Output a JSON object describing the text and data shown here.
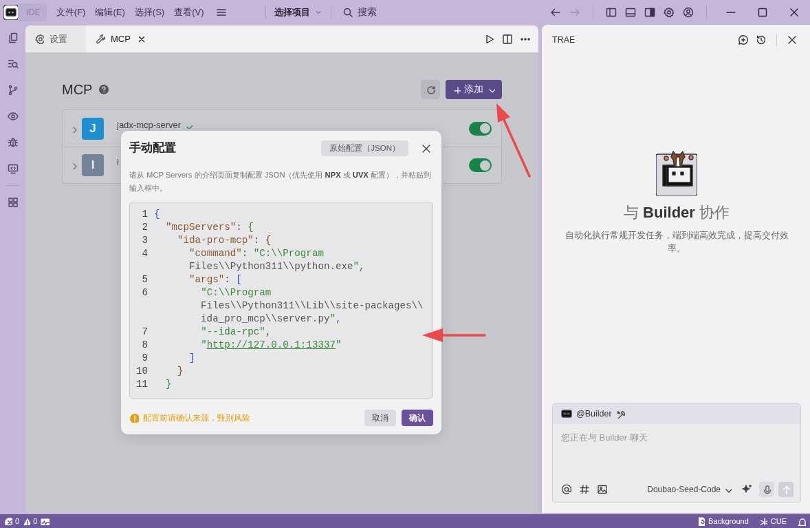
{
  "titlebar": {
    "mode_label": "IDE",
    "menus": [
      "文件(F)",
      "编辑(E)",
      "选择(S)",
      "查看(V)"
    ],
    "project": "选择项目",
    "search": "搜索"
  },
  "editor": {
    "tabs": [
      {
        "label": "设置",
        "kind": "settings",
        "selected": false
      },
      {
        "label": "MCP",
        "kind": "tool",
        "selected": true
      }
    ]
  },
  "page": {
    "title": "MCP",
    "add_button": "添加",
    "servers": [
      {
        "initial": "J",
        "name": "jadx-mcp-server",
        "color": "#1f8fd2",
        "verified": true,
        "on": true
      },
      {
        "initial": "I",
        "name": "i",
        "color": "#74839a",
        "verified": false,
        "on": true
      }
    ]
  },
  "dialog": {
    "title": "手动配置",
    "raw_button": "原始配置（JSON）",
    "description": "请从 MCP Servers 的介绍页面复制配置 JSON（优先使用 **NPX** 或 **UVX** 配置），并粘贴到输入框中。",
    "code": [
      {
        "number": "1",
        "rows": [
          "{"
        ]
      },
      {
        "number": "2",
        "rows": [
          "  \"mcpServers\": {"
        ]
      },
      {
        "number": "3",
        "rows": [
          "    \"ida-pro-mcp\": {"
        ]
      },
      {
        "number": "4",
        "rows": [
          "      \"command\": \"C:\\\\Program",
          "      Files\\\\Python311\\\\python.exe\","
        ]
      },
      {
        "number": "5",
        "rows": [
          "      \"args\": ["
        ]
      },
      {
        "number": "6",
        "rows": [
          "        \"C:\\\\Program",
          "        Files\\\\Python311\\\\Lib\\\\site-packages\\\\",
          "        ida_pro_mcp\\\\server.py\","
        ]
      },
      {
        "number": "7",
        "rows": [
          "        \"--ida-rpc\","
        ]
      },
      {
        "number": "8",
        "rows": [
          "        \"http://127.0.0.1:13337\""
        ]
      },
      {
        "number": "9",
        "rows": [
          "      ]"
        ]
      },
      {
        "number": "10",
        "rows": [
          "    }"
        ]
      },
      {
        "number": "11",
        "rows": [
          "  }"
        ]
      }
    ],
    "warning": "配置前请确认来源，甄别风险",
    "cancel": "取消",
    "confirm": "确认"
  },
  "assistant": {
    "title": "TRAE",
    "hero_title": "与 **Builder** 协作",
    "hero_text": "自动化执行常规开发任务，端到端高效完成，提高交付效率。",
    "mention": "@Builder",
    "placeholder": "您正在与 Builder 聊天",
    "model": "Doubao-Seed-Code"
  },
  "status_bar": {
    "errors": "0",
    "warnings": "0",
    "background": "Background",
    "cue": "CUE"
  }
}
